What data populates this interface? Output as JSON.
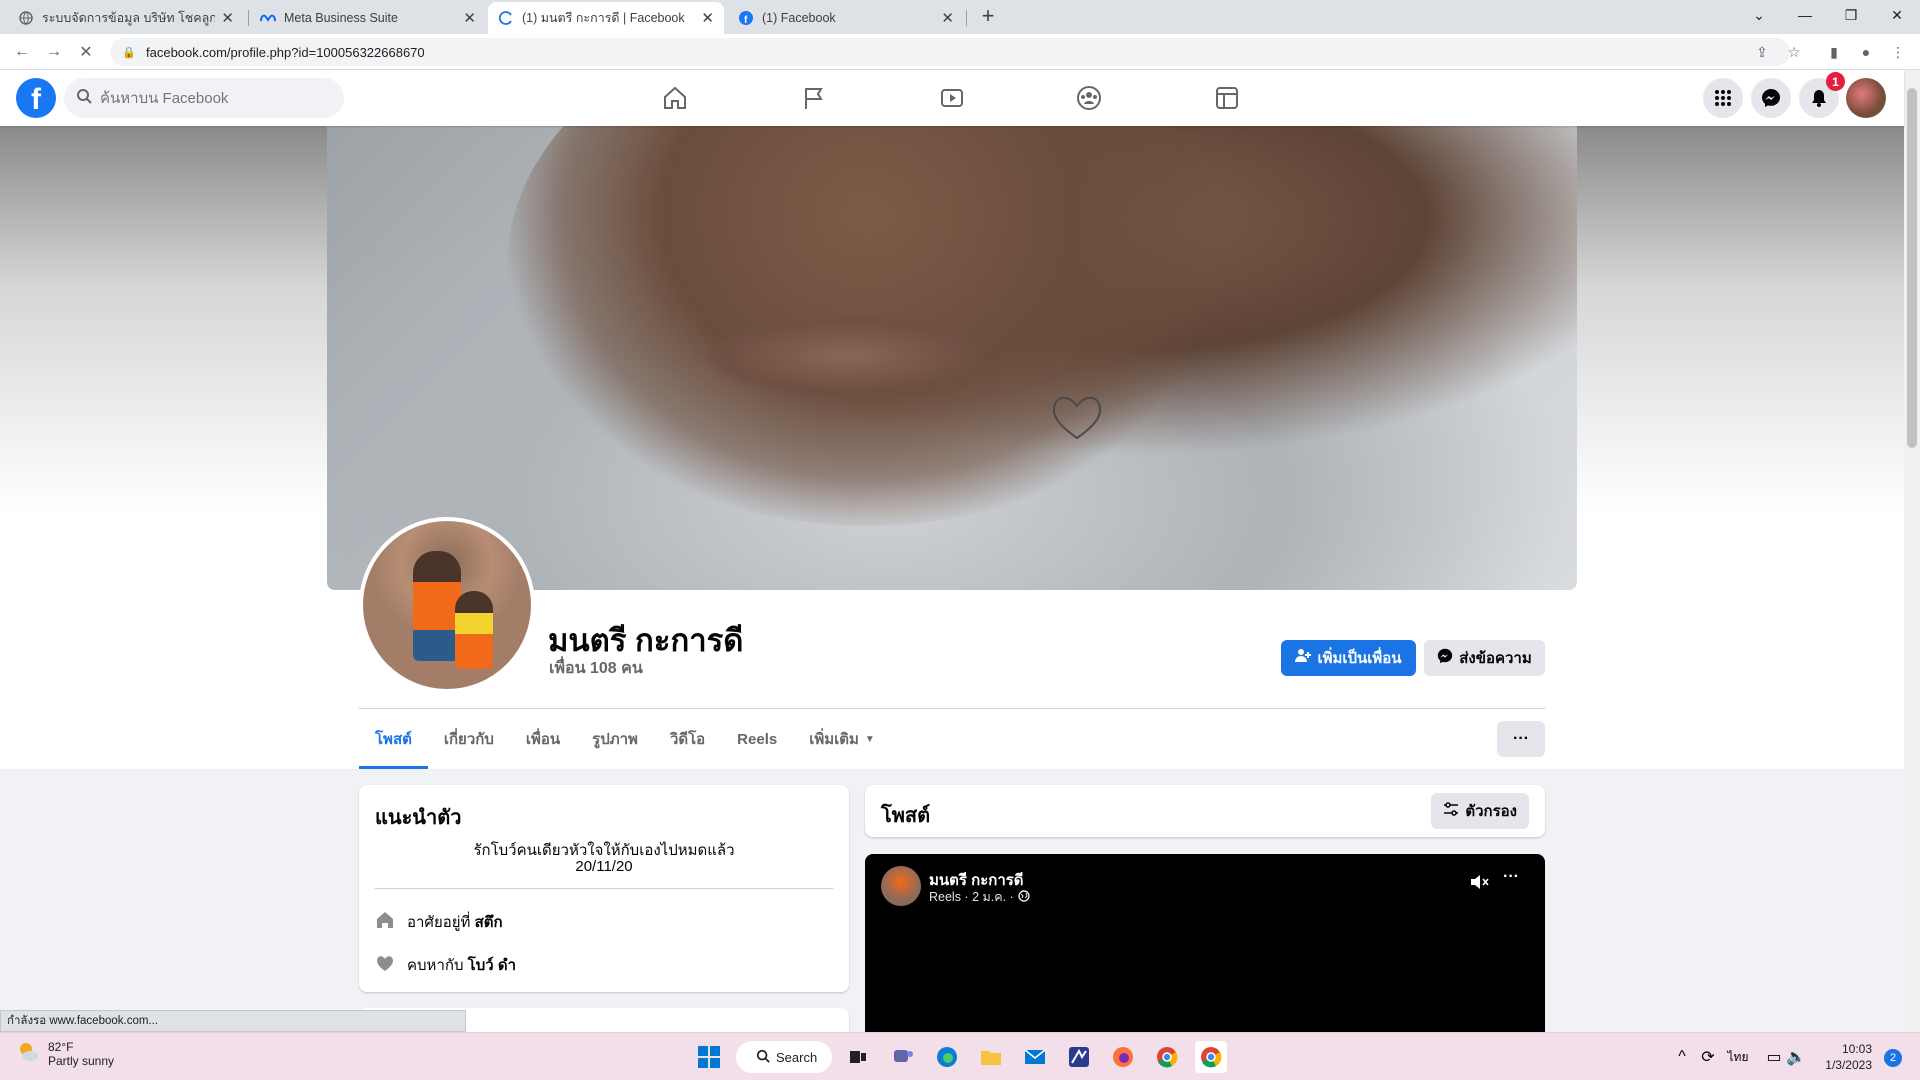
{
  "browser": {
    "tabs": [
      {
        "title": "ระบบจัดการข้อมูล บริษัท โชคลูกโชค ."
      },
      {
        "title": "Meta Business Suite"
      },
      {
        "title": "(1) มนตรี กะการดี | Facebook"
      },
      {
        "title": "(1) Facebook"
      }
    ],
    "url": "facebook.com/profile.php?id=100056322668670",
    "status_text": "กำลังรอ www.facebook.com..."
  },
  "fb": {
    "search_placeholder": "ค้นหาบน Facebook",
    "notification_count": "1"
  },
  "profile": {
    "name": "มนตรี กะการดี",
    "friends": "เพื่อน 108 คน",
    "add_friend_label": "เพิ่มเป็นเพื่อน",
    "message_label": "ส่งข้อความ",
    "tabs": [
      "โพสต์",
      "เกี่ยวกับ",
      "เพื่อน",
      "รูปภาพ",
      "วิดีโอ",
      "Reels",
      "เพิ่มเติม"
    ]
  },
  "intro": {
    "title": "แนะนำตัว",
    "bio_line1": "รักโบว์คนเดียวหัวใจให้กับเองไปหมดแล้ว",
    "bio_line2": "20/11/20",
    "lives_prefix": "อาศัยอยู่ที่",
    "lives_value": "สตึก",
    "dating_prefix": "คบหากับ",
    "dating_value": "โบว์ ดำ"
  },
  "posts": {
    "title": "โพสต์",
    "filter_label": "ตัวกรอง",
    "reel_author": "มนตรี กะการดี",
    "reel_meta": "Reels · 2 ม.ค. ·"
  },
  "taskbar": {
    "temp": "82°F",
    "weather": "Partly sunny",
    "search_label": "Search",
    "lang": "ไทย",
    "time": "10:03",
    "date": "1/3/2023",
    "notif_count": "2"
  },
  "colors": {
    "fb_blue": "#1877f2",
    "accent": "#1b74e4",
    "badge_red": "#e41e3f"
  }
}
